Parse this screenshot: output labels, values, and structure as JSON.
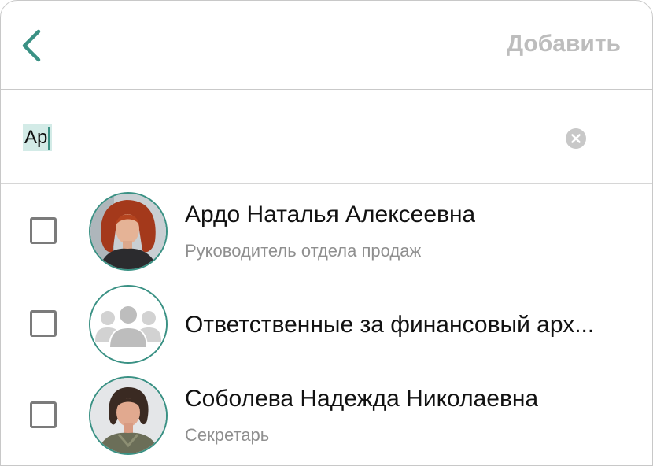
{
  "header": {
    "back_icon": "chevron-left-icon",
    "add_label": "Добавить"
  },
  "search": {
    "value": "Ар",
    "clear_icon": "clear-circle-icon"
  },
  "colors": {
    "accent": "#3a9184",
    "selection": "#d3ebe7",
    "disabled_text": "#bdbdbd",
    "secondary_text": "#8f8f8f"
  },
  "contacts": [
    {
      "name": "Ардо Наталья Алексеевна",
      "subtitle": "Руководитель отдела продаж",
      "avatar": "photo-avatar",
      "checked": false
    },
    {
      "name": "Ответственные за финансовый арх...",
      "subtitle": "",
      "avatar": "group-avatar-icon",
      "checked": false
    },
    {
      "name": "Соболева Надежда Николаевна",
      "subtitle": "Секретарь",
      "avatar": "photo-avatar",
      "checked": false
    }
  ]
}
